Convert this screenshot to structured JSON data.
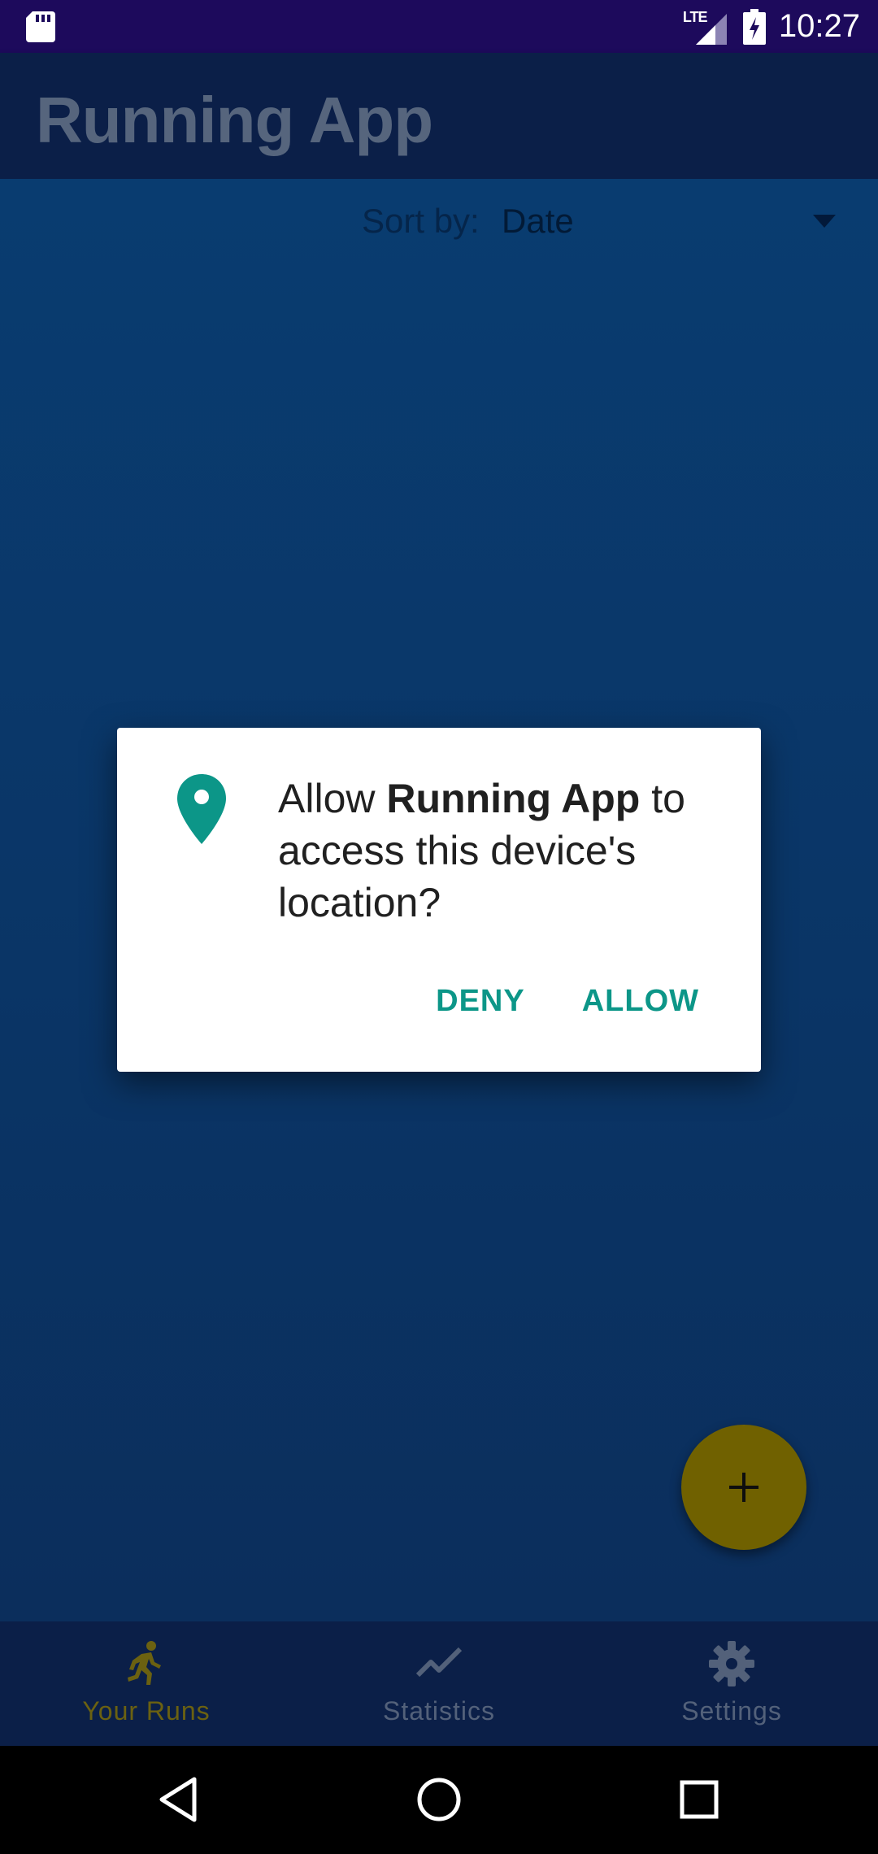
{
  "status_bar": {
    "time": "10:27",
    "network": "LTE",
    "icons": [
      "sd-card-icon",
      "lte-signal-icon",
      "battery-charging-icon"
    ]
  },
  "app_bar": {
    "title": "Running App"
  },
  "sort": {
    "label": "Sort by:",
    "value": "Date"
  },
  "dialog": {
    "prefix": "Allow ",
    "app_name": "Running App",
    "suffix": " to access this device's location?",
    "deny_label": "DENY",
    "allow_label": "ALLOW",
    "icon": "location-pin-icon",
    "accent_color": "#0c9688"
  },
  "fab": {
    "icon": "plus-icon",
    "color": "#706100"
  },
  "bottom_nav": {
    "items": [
      {
        "label": "Your Runs",
        "icon": "runner-icon",
        "active": true
      },
      {
        "label": "Statistics",
        "icon": "trend-line-icon",
        "active": false
      },
      {
        "label": "Settings",
        "icon": "gear-icon",
        "active": false
      }
    ]
  },
  "system_nav": {
    "buttons": [
      "back-icon",
      "home-icon",
      "recents-icon"
    ]
  },
  "colors": {
    "status_bar": "#1d0a5c",
    "app_bar": "#0b1f48",
    "content_bg": "#0a3566",
    "nav_active": "#6b6111",
    "nav_inactive": "#53617a"
  }
}
